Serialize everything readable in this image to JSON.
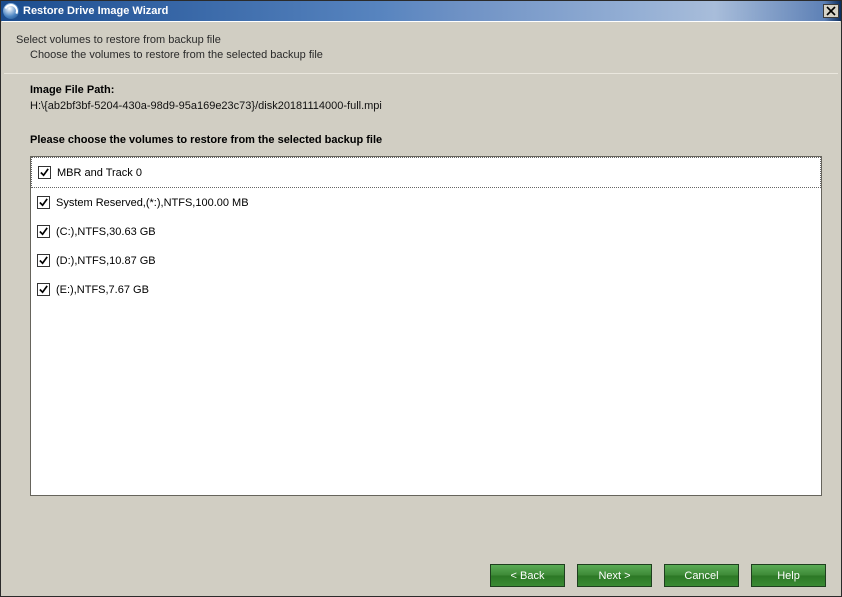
{
  "window": {
    "title": "Restore Drive Image Wizard",
    "close_label": "✕"
  },
  "intro": {
    "main": "Select volumes to restore from backup file",
    "sub": "Choose the volumes to restore from the selected backup file"
  },
  "file_label": "Image File Path:",
  "file_path": "H:\\{ab2bf3bf-5204-430a-98d9-95a169e23c73}/disk20181114000-full.mpi",
  "select_label": "Please choose the volumes to restore from the selected backup file",
  "volumes": [
    {
      "label": "MBR and Track 0",
      "checked": true
    },
    {
      "label": "System Reserved,(*:),NTFS,100.00 MB",
      "checked": true
    },
    {
      "label": "(C:),NTFS,30.63 GB",
      "checked": true
    },
    {
      "label": "(D:),NTFS,10.87 GB",
      "checked": true
    },
    {
      "label": "(E:),NTFS,7.67 GB",
      "checked": true
    }
  ],
  "buttons": {
    "back": "< Back",
    "next": "Next >",
    "cancel": "Cancel",
    "help": "Help"
  }
}
